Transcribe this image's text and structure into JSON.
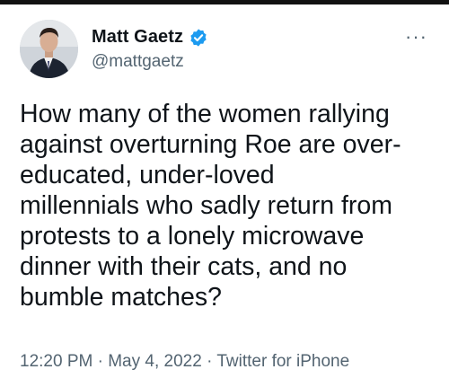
{
  "tweet": {
    "author": {
      "display_name": "Matt Gaetz",
      "handle": "@mattgaetz",
      "verified": true
    },
    "text": "How many of the women rallying\nagainst overturning Roe are over-\neducated, under-loved\nmillennials who sadly return from\nprotests to a lonely microwave\ndinner with their cats, and no\nbumble matches?",
    "time": "12:20 PM",
    "separator": "·",
    "date": "May 4, 2022",
    "source": "Twitter for iPhone"
  },
  "colors": {
    "text_primary": "#0f1419",
    "text_secondary": "#536471",
    "verified_blue": "#1d9bf0"
  },
  "icons": {
    "verified": "verified-badge-icon",
    "more": "more-options-icon"
  }
}
